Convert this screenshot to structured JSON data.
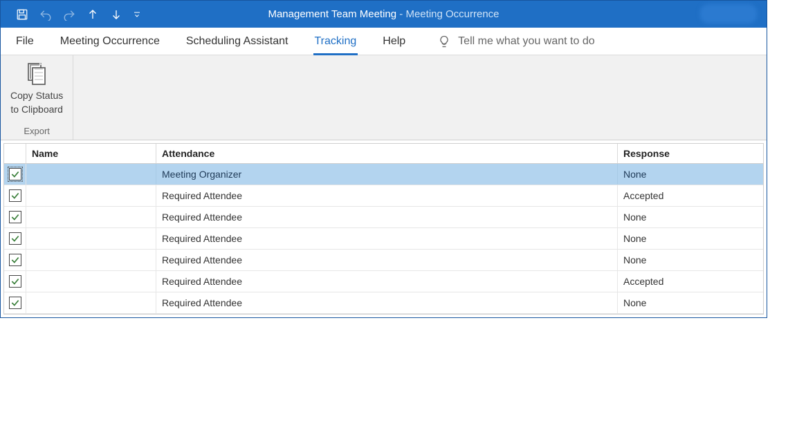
{
  "title": {
    "meeting_name": "Management Team Meeting",
    "separator": "  -  ",
    "context": "Meeting Occurrence"
  },
  "tabs": [
    {
      "label": "File"
    },
    {
      "label": "Meeting Occurrence"
    },
    {
      "label": "Scheduling Assistant"
    },
    {
      "label": "Tracking"
    },
    {
      "label": "Help"
    }
  ],
  "tellme": {
    "placeholder": "Tell me what you want to do"
  },
  "ribbon": {
    "copy_status_line1": "Copy Status",
    "copy_status_line2": "to Clipboard",
    "group_label": "Export"
  },
  "grid": {
    "headers": {
      "name": "Name",
      "attendance": "Attendance",
      "response": "Response"
    },
    "rows": [
      {
        "checked": true,
        "name": "",
        "attendance": "Meeting Organizer",
        "response": "None",
        "selected": true,
        "focused": true
      },
      {
        "checked": true,
        "name": "",
        "attendance": "Required Attendee",
        "response": "Accepted"
      },
      {
        "checked": true,
        "name": "",
        "attendance": "Required Attendee",
        "response": "None"
      },
      {
        "checked": true,
        "name": "",
        "attendance": "Required Attendee",
        "response": "None"
      },
      {
        "checked": true,
        "name": "",
        "attendance": "Required Attendee",
        "response": "None"
      },
      {
        "checked": true,
        "name": "",
        "attendance": "Required Attendee",
        "response": "Accepted"
      },
      {
        "checked": true,
        "name": "",
        "attendance": "Required Attendee",
        "response": "None"
      }
    ]
  }
}
